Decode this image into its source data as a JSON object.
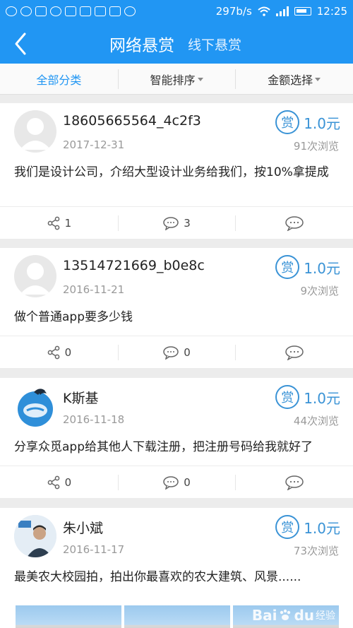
{
  "status_bar": {
    "network_speed": "297b/s",
    "time": "12:25"
  },
  "title_bar": {
    "title": "网络悬赏",
    "subtitle": "线下悬赏"
  },
  "filters": [
    {
      "label": "全部分类"
    },
    {
      "label": "智能排序"
    },
    {
      "label": "金额选择"
    }
  ],
  "posts": [
    {
      "username": "18605665564_4c2f3",
      "date": "2017-12-31",
      "reward_badge": "赏",
      "reward_amount": "1.0元",
      "views": "91次浏览",
      "content": "我们是设计公司，介绍大型设计业务给我们，按10%拿提成",
      "share_count": "1",
      "comment_count": "3"
    },
    {
      "username": "13514721669_b0e8c",
      "date": "2016-11-21",
      "reward_badge": "赏",
      "reward_amount": "1.0元",
      "views": "9次浏览",
      "content": "做个普通app要多少钱",
      "share_count": "0",
      "comment_count": "0"
    },
    {
      "username": "K斯基",
      "date": "2016-11-18",
      "reward_badge": "赏",
      "reward_amount": "1.0元",
      "views": "44次浏览",
      "content": "分享众觅app给其他人下载注册，把注册号码给我就好了",
      "share_count": "0",
      "comment_count": "0"
    },
    {
      "username": "朱小斌",
      "date": "2016-11-17",
      "reward_badge": "赏",
      "reward_amount": "1.0元",
      "views": "73次浏览",
      "content": "最美农大校园拍，拍出你最喜欢的农大建筑、风景......"
    }
  ],
  "watermark": {
    "brand": "Bai",
    "suffix": "du",
    "label": "经验"
  },
  "colors": {
    "primary": "#2196f3",
    "reward": "#3a93d6"
  }
}
